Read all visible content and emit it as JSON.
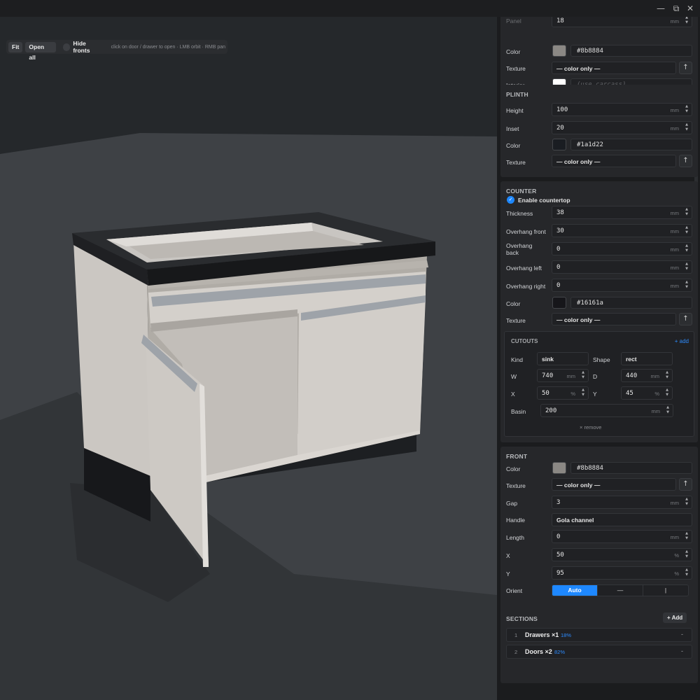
{
  "window": {
    "minimize": "—",
    "maximize": "⧉",
    "close": "✕"
  },
  "toolbar": {
    "fit": "Fit",
    "open_all": "Open all",
    "hide_fronts": "Hide fronts",
    "hint": "click on door / drawer to open · LMB orbit · RMB pan"
  },
  "units": {
    "mm": "mm",
    "pct": "%"
  },
  "carcass": {
    "partial_label": "Panel",
    "partial_value": "18",
    "color_label": "Color",
    "color_hex": "#8b8884",
    "texture_label": "Texture",
    "texture_value": "— color only —",
    "interior_label": "Interior",
    "interior_color": "#ffffff",
    "interior_placeholder": "(use carcass)"
  },
  "plinth": {
    "title": "PLINTH",
    "height_label": "Height",
    "height_value": "100",
    "inset_label": "Inset",
    "inset_value": "20",
    "color_label": "Color",
    "color_hex": "#1a1d22",
    "texture_label": "Texture",
    "texture_value": "— color only —"
  },
  "counter": {
    "title": "COUNTER",
    "enable_label": "Enable countertop",
    "thickness_label": "Thickness",
    "thickness_value": "38",
    "overhang_front_label": "Overhang front",
    "overhang_front_value": "30",
    "overhang_back_label": "Overhang back",
    "overhang_back_value": "0",
    "overhang_left_label": "Overhang left",
    "overhang_left_value": "0",
    "overhang_right_label": "Overhang right",
    "overhang_right_value": "0",
    "color_label": "Color",
    "color_hex": "#16161a",
    "texture_label": "Texture",
    "texture_value": "— color only —",
    "cutouts": {
      "title": "CUTOUTS",
      "add": "+ add",
      "kind_label": "Kind",
      "kind_value": "sink",
      "shape_label": "Shape",
      "shape_value": "rect",
      "w_label": "W",
      "w_value": "740",
      "d_label": "D",
      "d_value": "440",
      "x_label": "X",
      "x_value": "50",
      "y_label": "Y",
      "y_value": "45",
      "basin_label": "Basin",
      "basin_value": "200",
      "remove": "× remove"
    }
  },
  "front": {
    "title": "FRONT",
    "color_label": "Color",
    "color_hex": "#8b8884",
    "texture_label": "Texture",
    "texture_value": "— color only —",
    "gap_label": "Gap",
    "gap_value": "3",
    "handle_label": "Handle",
    "handle_value": "Gola channel",
    "length_label": "Length",
    "length_value": "0",
    "x_label": "X",
    "x_value": "50",
    "y_label": "Y",
    "y_value": "95",
    "orient_label": "Orient",
    "orient_options": [
      "Auto",
      "—",
      "|"
    ],
    "orient_selected": "Auto"
  },
  "sections": {
    "title": "SECTIONS",
    "add": "+ Add",
    "items": [
      {
        "index": "1",
        "name": "Drawers ×1",
        "pct": "18%",
        "remove": "-"
      },
      {
        "index": "2",
        "name": "Doors ×2",
        "pct": "82%",
        "remove": "-"
      }
    ]
  }
}
